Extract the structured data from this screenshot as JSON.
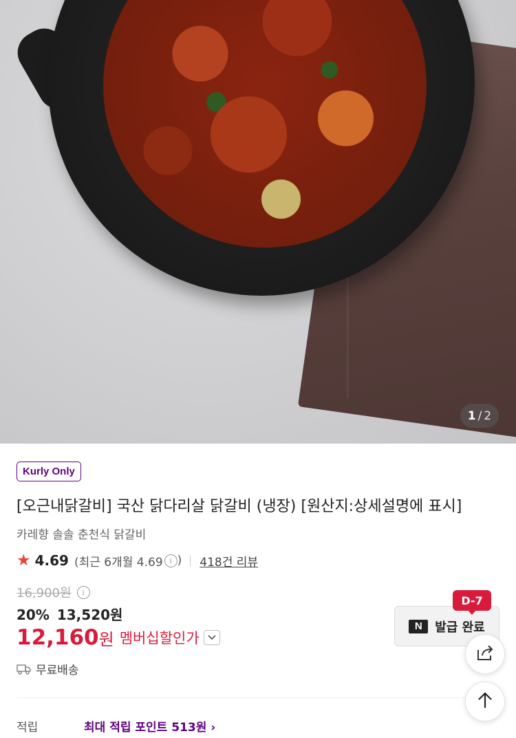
{
  "gallery": {
    "current_page": "1",
    "separator": "/",
    "total_pages": "2"
  },
  "product": {
    "badge": "Kurly Only",
    "title": "[오근내닭갈비] 국산 닭다리살 닭갈비 (냉장) [원산지:상세설명에 표시]",
    "subtitle": "카레향 솔솔 춘천식 닭갈비",
    "rating": "4.69",
    "recent_rating_prefix": "(최근 6개월 4.69",
    "recent_rating_suffix": ")",
    "review_count": "418건 리뷰"
  },
  "pricing": {
    "original_price": "16,900원",
    "discount_percent": "20%",
    "sale_price": "13,520원",
    "member_price": "12,160",
    "member_unit": "원",
    "member_label": "멤버십할인가"
  },
  "delivery": {
    "text": "무료배송"
  },
  "points": {
    "label": "적립",
    "value": "최대 적립 포인트 513원 ›"
  },
  "coupon": {
    "logo": "N",
    "label": "발급 완료",
    "dday": "D-7"
  },
  "colors": {
    "brand_purple": "#5f0080",
    "price_red": "#d91b3b",
    "star_red": "#e8433a"
  },
  "icons": {
    "star": "star-icon",
    "info": "info-icon",
    "chevron": "chevron-down-icon",
    "truck": "truck-icon",
    "share": "share-icon",
    "scroll_top": "arrow-up-icon"
  }
}
